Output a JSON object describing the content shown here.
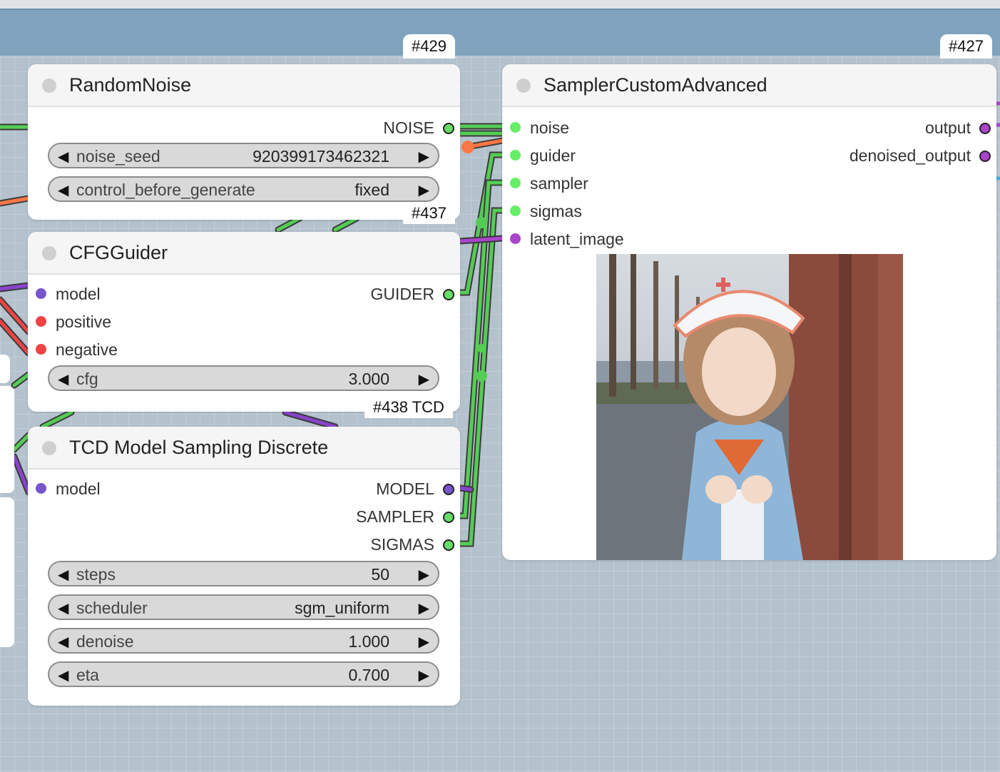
{
  "colors": {
    "noise": "#66dd66",
    "guider": "#66dd66",
    "latent": "#aa44cc",
    "model": "#7755cc",
    "conditioning": "#ee4444",
    "orange": "#ff7744"
  },
  "nodes": {
    "random_noise": {
      "badge": "#429",
      "title": "RandomNoise",
      "outputs": [
        "NOISE"
      ],
      "widgets": [
        {
          "label": "noise_seed",
          "value": "920399173462321"
        },
        {
          "label": "control_before_generate",
          "value": "fixed"
        }
      ]
    },
    "cfg_guider": {
      "badge": "#437",
      "title": "CFGGuider",
      "inputs": [
        "model",
        "positive",
        "negative"
      ],
      "outputs": [
        "GUIDER"
      ],
      "widgets": [
        {
          "label": "cfg",
          "value": "3.000"
        }
      ]
    },
    "tcd": {
      "badge": "#438 TCD",
      "title": "TCD Model Sampling Discrete",
      "inputs": [
        "model"
      ],
      "outputs": [
        "MODEL",
        "SAMPLER",
        "SIGMAS"
      ],
      "widgets": [
        {
          "label": "steps",
          "value": "50"
        },
        {
          "label": "scheduler",
          "value": "sgm_uniform"
        },
        {
          "label": "denoise",
          "value": "1.000"
        },
        {
          "label": "eta",
          "value": "0.700"
        }
      ]
    },
    "sampler": {
      "badge": "#427",
      "title": "SamplerCustomAdvanced",
      "inputs": [
        "noise",
        "guider",
        "sampler",
        "sigmas",
        "latent_image"
      ],
      "outputs": [
        "output",
        "denoised_output"
      ],
      "preview_icon": "preview-image"
    }
  }
}
